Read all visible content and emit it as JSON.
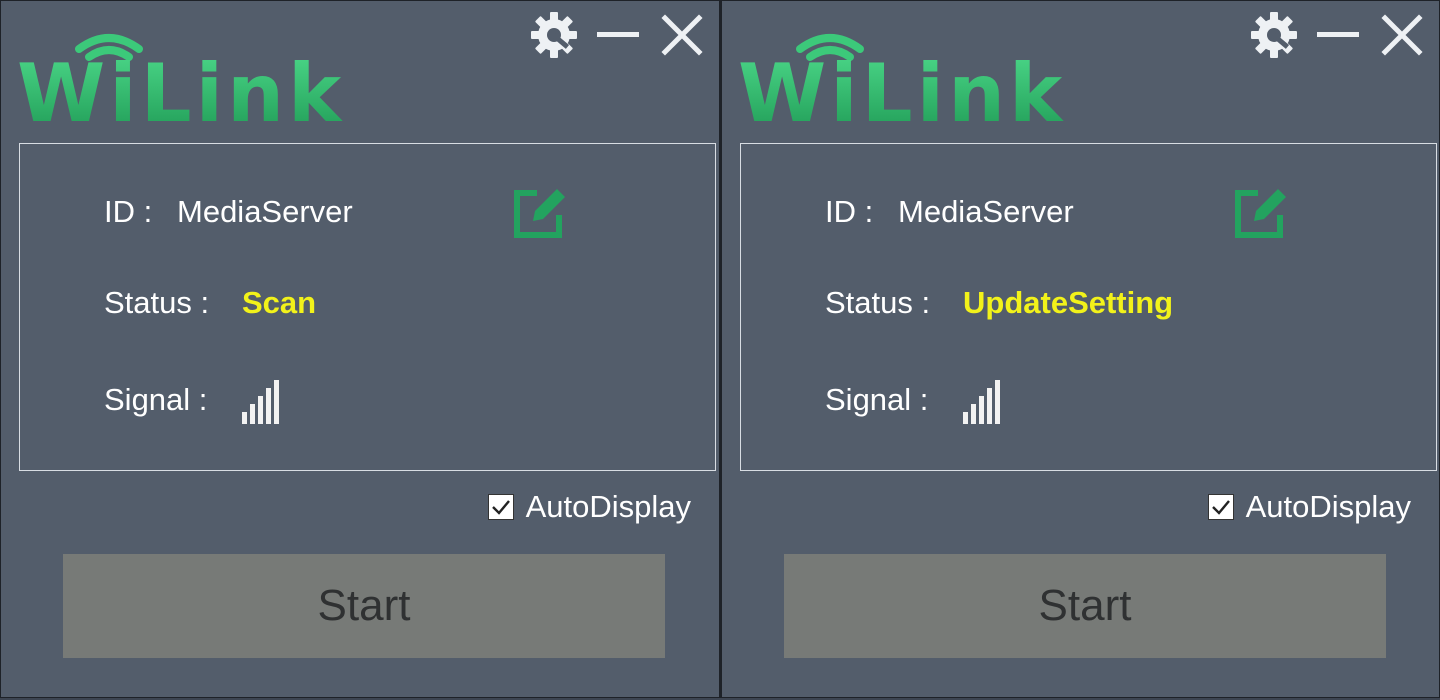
{
  "colors": {
    "background": "#535d6b",
    "logo_green": "#2fb36a",
    "status_yellow": "#f2f21a",
    "button_gray": "#777a77"
  },
  "panels": [
    {
      "logo_text": "WiLink",
      "icons": {
        "settings": "gear-icon",
        "minimize": "minimize-icon",
        "close": "close-icon",
        "edit": "edit-icon",
        "signal": "signal-icon"
      },
      "id_label": "ID :",
      "id_value": "MediaServer",
      "status_label": "Status :",
      "status_value": "Scan",
      "signal_label": "Signal :",
      "signal_bars": 5,
      "autodisplay_label": "AutoDisplay",
      "autodisplay_checked": true,
      "start_label": "Start"
    },
    {
      "logo_text": "WiLink",
      "icons": {
        "settings": "gear-icon",
        "minimize": "minimize-icon",
        "close": "close-icon",
        "edit": "edit-icon",
        "signal": "signal-icon"
      },
      "id_label": "ID :",
      "id_value": "MediaServer",
      "status_label": "Status :",
      "status_value": "UpdateSetting",
      "signal_label": "Signal :",
      "signal_bars": 5,
      "autodisplay_label": "AutoDisplay",
      "autodisplay_checked": true,
      "start_label": "Start"
    }
  ]
}
